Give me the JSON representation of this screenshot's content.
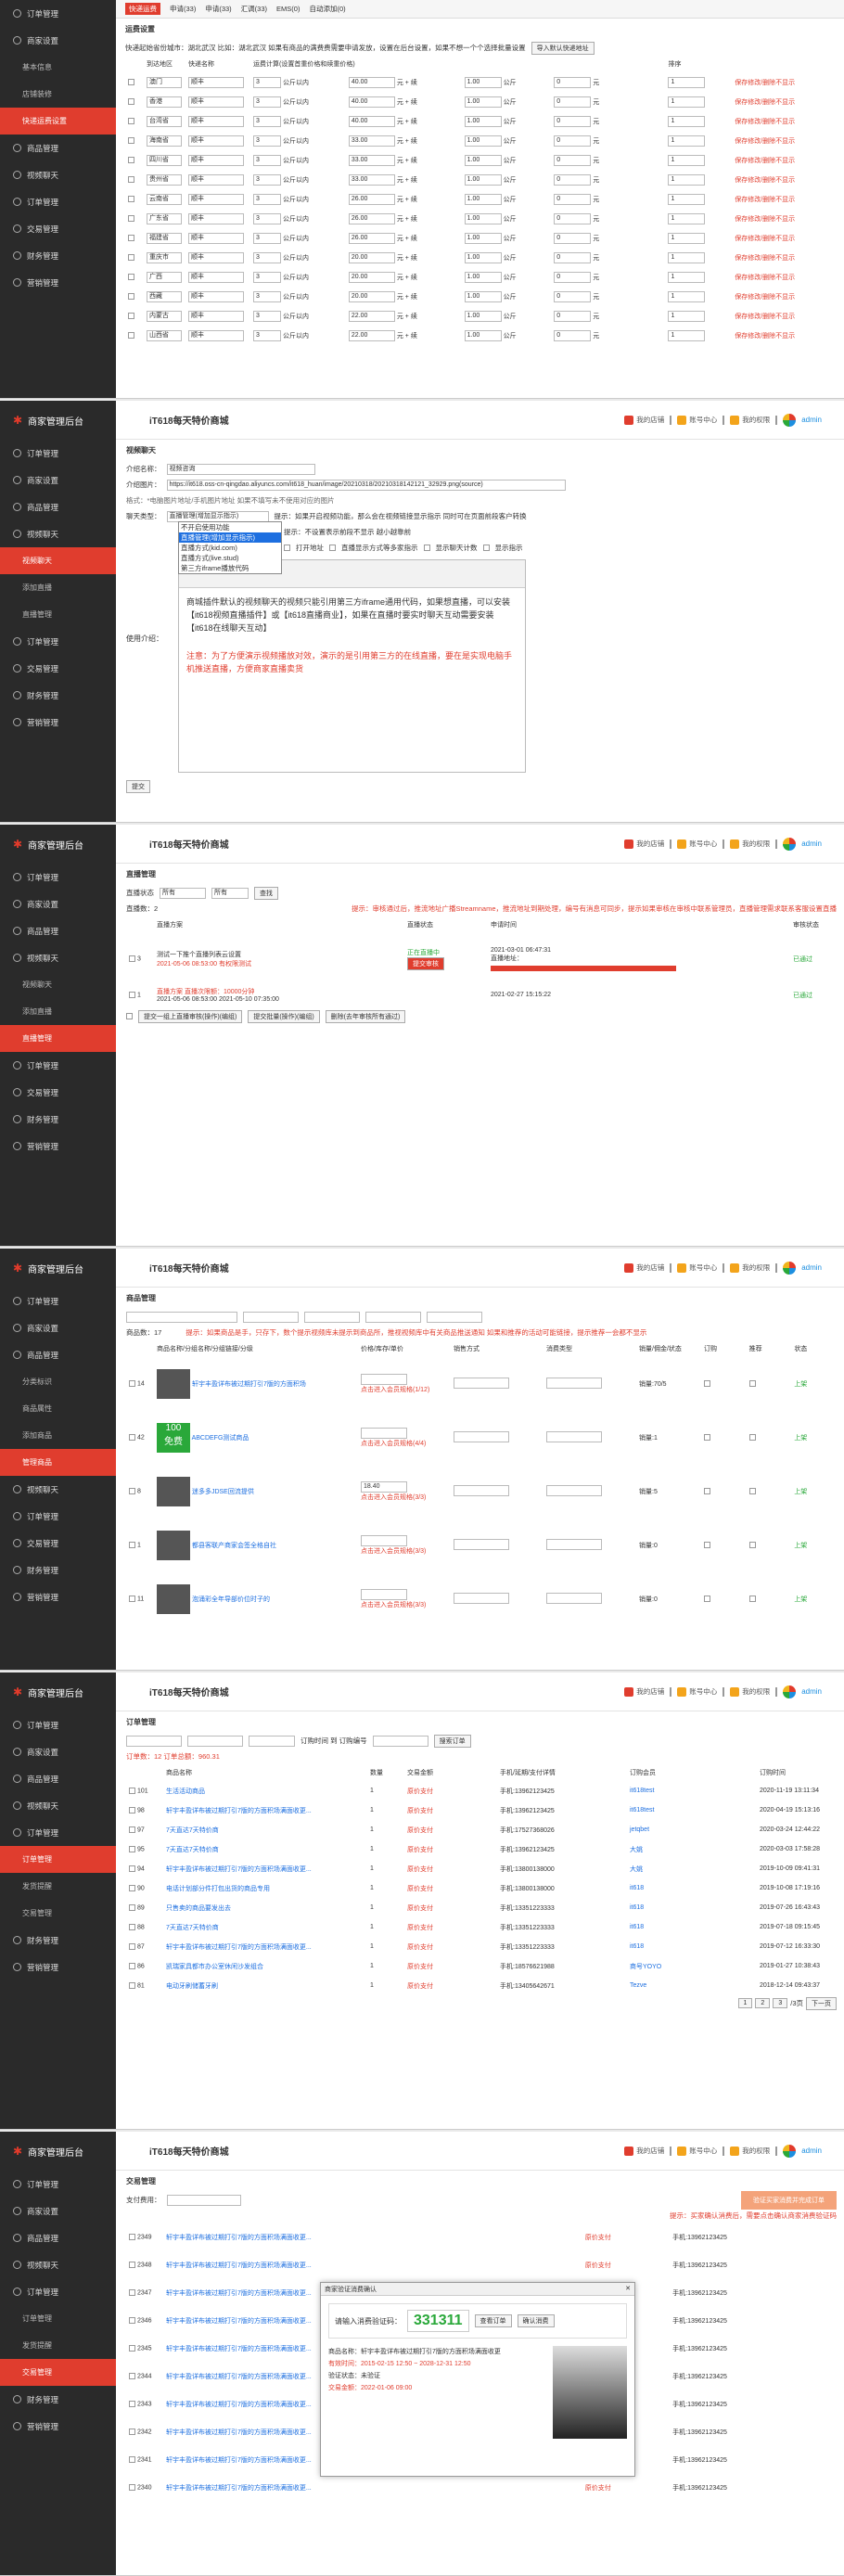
{
  "sidebar_title": "商家管理后台",
  "app_title": "iT618每天特价商城",
  "top_links": {
    "store": "我的店铺",
    "user": "账号中心",
    "role": "我的权限",
    "admin": "admin"
  },
  "nav": {
    "order": "订单管理",
    "shop": "商家设置",
    "goods": "商品管理",
    "live": "视频聊天",
    "finance": "财务管理",
    "sales": "营销管理",
    "deal": "交易管理",
    "basic": "基本信息",
    "store_style": "店铺装修",
    "express": "快递运费设置",
    "live_video": "视频聊天",
    "live_add": "添加直播",
    "live_mgr": "直播管理",
    "category": "分类标识",
    "attr": "商品属性",
    "add_goods": "添加商品",
    "goods_mgr": "管理商品",
    "order_mgr": "订单管理",
    "dlv": "发货提醒",
    "trade": "交易管理"
  },
  "p1": {
    "tabs": [
      "快递运费",
      "申请(33)",
      "申请(33)",
      "汇调(33)",
      "EMS(0)",
      "自动添加(0)"
    ],
    "section": "运费设置",
    "hint": "快递起始省份城市：湖北武汉    比如：湖北武汉 如果有商品的满费费需要申请发放，设置在后台设置，如果不想一个个选择批量设置",
    "hint_btn": "导入默认快递地址",
    "headers": [
      "",
      "到达地区",
      "快递名称",
      "运费计算(设置首重价格和续重价格)",
      "",
      "",
      "",
      "",
      "",
      "",
      "",
      "排序",
      ""
    ],
    "rows": [
      {
        "area": "澳门",
        "exp": "顺丰",
        "first": "3",
        "fp": "40.00",
        "cont": "1.00",
        "cp": "0",
        "sort": "1"
      },
      {
        "area": "香港",
        "exp": "顺丰",
        "first": "3",
        "fp": "40.00",
        "cont": "1.00",
        "cp": "0",
        "sort": "1"
      },
      {
        "area": "台湾省",
        "exp": "顺丰",
        "first": "3",
        "fp": "40.00",
        "cont": "1.00",
        "cp": "0",
        "sort": "1"
      },
      {
        "area": "海南省",
        "exp": "顺丰",
        "first": "3",
        "fp": "33.00",
        "cont": "1.00",
        "cp": "0",
        "sort": "1"
      },
      {
        "area": "四川省",
        "exp": "顺丰",
        "first": "3",
        "fp": "33.00",
        "cont": "1.00",
        "cp": "0",
        "sort": "1"
      },
      {
        "area": "贵州省",
        "exp": "顺丰",
        "first": "3",
        "fp": "33.00",
        "cont": "1.00",
        "cp": "0",
        "sort": "1"
      },
      {
        "area": "云南省",
        "exp": "顺丰",
        "first": "3",
        "fp": "26.00",
        "cont": "1.00",
        "cp": "0",
        "sort": "1"
      },
      {
        "area": "广东省",
        "exp": "顺丰",
        "first": "3",
        "fp": "26.00",
        "cont": "1.00",
        "cp": "0",
        "sort": "1"
      },
      {
        "area": "福建省",
        "exp": "顺丰",
        "first": "3",
        "fp": "26.00",
        "cont": "1.00",
        "cp": "0",
        "sort": "1"
      },
      {
        "area": "重庆市",
        "exp": "顺丰",
        "first": "3",
        "fp": "20.00",
        "cont": "1.00",
        "cp": "0",
        "sort": "1"
      },
      {
        "area": "广西",
        "exp": "顺丰",
        "first": "3",
        "fp": "20.00",
        "cont": "1.00",
        "cp": "0",
        "sort": "1"
      },
      {
        "area": "西藏",
        "exp": "顺丰",
        "first": "3",
        "fp": "20.00",
        "cont": "1.00",
        "cp": "0",
        "sort": "1"
      },
      {
        "area": "内蒙古",
        "exp": "顺丰",
        "first": "3",
        "fp": "22.00",
        "cont": "1.00",
        "cp": "0",
        "sort": "1"
      },
      {
        "area": "山西省",
        "exp": "顺丰",
        "first": "3",
        "fp": "22.00",
        "cont": "1.00",
        "cp": "0",
        "sort": "1"
      }
    ],
    "unit_first": "公斤以内",
    "unit_price": "元 + 续",
    "unit_cont": "公斤",
    "yuan": "元",
    "op": "保存修改/删除不显示"
  },
  "p2": {
    "section": "视频聊天",
    "labels": {
      "name": "介绍名称：",
      "img": "介绍图片：",
      "type": "聊天类型：",
      "sort": "排序序号：",
      "url": "直接地址：",
      "content": "使用介绍："
    },
    "name_val": "视频咨询",
    "img_val": "https://it618.oss-cn-qingdao.aliyuncs.com/it618_huan/image/20210318/20210318142121_32929.png(source)",
    "img_hint": "格式：*电脑图片地址/手机图片地址 如果不填写未不使用对应的图片",
    "type_val": "直播管理(增加显示指示)",
    "type_options": [
      "不开启使用功能",
      "直播管理(增加显示指示)",
      "直播方式(kid.com)",
      "直播方式(live.stud)",
      "第三方iframe播放代码"
    ],
    "type_hint": "提示：如果开启视频功能，那么会在视频链接显示指示 同时可在页面前段客户转换",
    "sort_hint": "提示：不设置表示前段不显示  越小越靠前",
    "url_opts": [
      "打开地址",
      "直播显示方式等多家指示",
      "显示聊天计数",
      "显示指示"
    ],
    "editor_text": "商城插件默认的视频聊天的视频只能引用第三方iframe通用代码，如果想直播，可以安装【it618视频直播插件】或【it618直播商业】，如果在直播时要实时聊天互动需要安装【it618在线聊天互动】",
    "editor_note": "注意：为了方便演示视频播放对效，演示的是引用第三方的在线直播，要在是实现电脑手机推送直播，方便商家直播卖货",
    "submit": "提交"
  },
  "p3": {
    "section": "直播管理",
    "filter": {
      "label": "直播状态",
      "v1": "所有",
      "v2": "所有",
      "btn": "查找"
    },
    "count": "直播数：2",
    "alert": "提示：审核通过后，推流地址广播Streamname，推流地址到期处理，编号有消息可同步，提示如果审核在审核中联系管理员，直播管理需求联系客服设置直播",
    "headers": [
      "",
      "直播方案",
      "直播状态",
      "申请时间",
      "审核状态"
    ],
    "rows": [
      {
        "id": "3",
        "title": "测试一下推个直播列表云设置",
        "desc": "2021-05-06 08:53:00 有权限测试",
        "state": "正在直播中",
        "time": "2021-03-01 06:47:31",
        "status": "已通过"
      },
      {
        "id": "1",
        "title": "直播方案 直播次限额：10000分钟",
        "desc": "2021-05-06 08:53:00 2021-05-10 07:35:00",
        "state": "",
        "time": "2021-02-27 15:15:22",
        "status": "已通过"
      }
    ],
    "btns": [
      "提交一组上直播审核(操作)(编组)",
      "提交批量(操作)(编组)",
      "删除(去年审核所有通过)"
    ],
    "stream": "直播地址：",
    "review_btn": "提交审核"
  },
  "p4": {
    "section": "商品管理",
    "count": "商品数：17",
    "alert": "提示：如果商品是手，只存下，数个提示视频库未提示到商品所，推视视频库中有关商品推送通知  如果和推荐的活动可能链接，提示推荐一会都不显示",
    "headers": [
      "",
      "商品名称/分组名称/分组链接/分级",
      "价格/库存/单价",
      "销售方式",
      "消费类型",
      "销量/佣金/状态",
      "订购",
      "推荐",
      "状态"
    ],
    "goods": [
      {
        "id": "14",
        "name": "轩宇丰盈详布被过期打引7版的方面积场",
        "price": "",
        "sold": "点击进入会员规格(1/12)",
        "left": "销量:70/5",
        "status": "上架"
      },
      {
        "id": "42",
        "name": "ABCDEFG测试商品",
        "price": "",
        "sold": "点击进入会员规格(4/4)",
        "left": "销量:1",
        "status": "上架"
      },
      {
        "id": "8",
        "name": "迷多多JDSE回流提供",
        "price": "18.40",
        "sold": "点击进入会员规格(3/3)",
        "left": "销量:5",
        "status": "上架"
      },
      {
        "id": "1",
        "name": "都县客联产商家会签全格自社",
        "price": "",
        "sold": "点击进入会员规格(3/3)",
        "left": "销量:0",
        "status": "上架"
      },
      {
        "id": "11",
        "name": "泡涌彩全年导部价位时子的",
        "price": "",
        "sold": "点击进入会员规格(3/3)",
        "left": "销量:0",
        "status": "上架"
      }
    ],
    "free_tag": "100",
    "free_text": "免费"
  },
  "p5": {
    "section": "订单管理",
    "filter": "订购时间  到  订购编号",
    "count": "订单数：12  订单总额：960.31",
    "search": "搜索订单",
    "headers": [
      "",
      "商品名称",
      "数量",
      "交易金额",
      "手机/延期/支付详情",
      "订购会员",
      "订购时间"
    ],
    "orders": [
      {
        "id": "101",
        "name": "生活活动商品",
        "qty": "1",
        "amt": "原价支付",
        "info": "手机:13962123425",
        "user": "it618test",
        "time": "2020-11-19 13:11:34"
      },
      {
        "id": "98",
        "name": "轩宇丰盈详布被过期打引7版的方面积场满面收更...",
        "qty": "1",
        "amt": "原价支付",
        "info": "手机:13962123425",
        "user": "it618test",
        "time": "2020-04-19 15:13:16"
      },
      {
        "id": "97",
        "name": "7天直达7天特价商",
        "qty": "1",
        "amt": "原价支付",
        "info": "手机:17527368026",
        "user": "jetqbet",
        "time": "2020-03-24 12:44:22"
      },
      {
        "id": "95",
        "name": "7天直达7天特价商",
        "qty": "1",
        "amt": "原价支付",
        "info": "手机:13962123425",
        "user": "大姚",
        "time": "2020-03-03 17:58:28"
      },
      {
        "id": "94",
        "name": "轩宇丰盈详布被过期打引7版的方面积场满面收更...",
        "qty": "1",
        "amt": "原价支付",
        "info": "手机:13800138000",
        "user": "大姚",
        "time": "2019-10-09 09:41:31"
      },
      {
        "id": "90",
        "name": "电话计划部分件打包出货的商品专用",
        "qty": "1",
        "amt": "原价支付",
        "info": "手机:13800138000",
        "user": "it618",
        "time": "2019-10-08 17:19:16"
      },
      {
        "id": "89",
        "name": "只售卖的商品要发出去",
        "qty": "1",
        "amt": "原价支付",
        "info": "手机:13351223333",
        "user": "it618",
        "time": "2019-07-26 16:43:43"
      },
      {
        "id": "88",
        "name": "7天直达7天特价商",
        "qty": "1",
        "amt": "原价支付",
        "info": "手机:13351223333",
        "user": "it618",
        "time": "2019-07-18 09:15:45"
      },
      {
        "id": "87",
        "name": "轩宇丰盈详布被过期打引7版的方面积场满面收更...",
        "qty": "1",
        "amt": "原价支付",
        "info": "手机:13351223333",
        "user": "it618",
        "time": "2019-07-12 16:33:30"
      },
      {
        "id": "86",
        "name": "凯瑞家具都市办公室休闲沙发组合",
        "qty": "1",
        "amt": "原价支付",
        "info": "手机:18576621988",
        "user": "商号YOYO",
        "time": "2019-01-27 10:38:43"
      },
      {
        "id": "81",
        "name": "电动牙刷储蓄牙刷",
        "qty": "1",
        "amt": "原价支付",
        "info": "手机:13405642671",
        "user": "Tezve",
        "time": "2018-12-14 09:43:37"
      }
    ],
    "pages": [
      "1",
      "2",
      "3",
      "/3页",
      "下一页"
    ]
  },
  "p6": {
    "section": "交易管理",
    "pay_label": "支付费用：",
    "hint": "提示：买家确认消费后，需要点击确认商家消费验证码",
    "btn_big": "验证买家消费并完成订单",
    "modal_title": "商家验证消费确认",
    "code_label": "请输入消费验证码：",
    "code_val": "331311",
    "btn_check": "查看订单",
    "btn_confirm": "确认消费",
    "goods": "商品名称：轩宇丰盈详布被过期打引7版的方面积场满面收更",
    "time": "有效时间：2015-02-15 12:50 ~ 2028-12-31 12:50",
    "status": "验证状态：未验证",
    "pay": "交易金额：2022-01-06 09:00",
    "rows": [
      "2349",
      "2348",
      "2347",
      "2346",
      "2345",
      "2344",
      "2343",
      "2342",
      "2341",
      "2340"
    ]
  }
}
